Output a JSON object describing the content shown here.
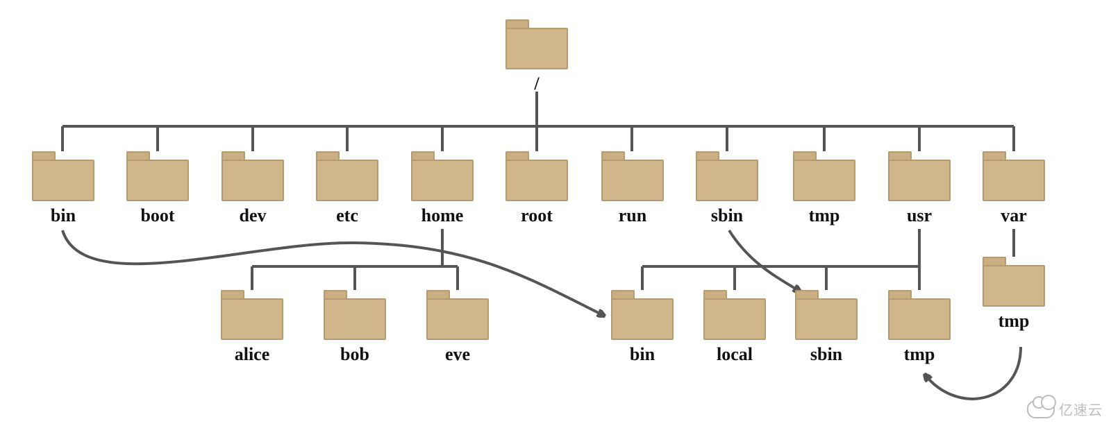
{
  "root": {
    "label": "/"
  },
  "level1": [
    {
      "id": "bin",
      "label": "bin"
    },
    {
      "id": "boot",
      "label": "boot"
    },
    {
      "id": "dev",
      "label": "dev"
    },
    {
      "id": "etc",
      "label": "etc"
    },
    {
      "id": "home",
      "label": "home"
    },
    {
      "id": "root",
      "label": "root"
    },
    {
      "id": "run",
      "label": "run"
    },
    {
      "id": "sbin",
      "label": "sbin"
    },
    {
      "id": "tmp",
      "label": "tmp"
    },
    {
      "id": "usr",
      "label": "usr"
    },
    {
      "id": "var",
      "label": "var"
    }
  ],
  "homeChildren": [
    {
      "id": "alice",
      "label": "alice"
    },
    {
      "id": "bob",
      "label": "bob"
    },
    {
      "id": "eve",
      "label": "eve"
    }
  ],
  "usrChildren": [
    {
      "id": "usr-bin",
      "label": "bin"
    },
    {
      "id": "usr-local",
      "label": "local"
    },
    {
      "id": "usr-sbin",
      "label": "sbin"
    },
    {
      "id": "usr-tmp",
      "label": "tmp"
    }
  ],
  "varChildren": [
    {
      "id": "var-tmp",
      "label": "tmp"
    }
  ],
  "symlinks": [
    {
      "from": "bin",
      "to": "usr/bin"
    },
    {
      "from": "sbin",
      "to": "usr/sbin"
    },
    {
      "from": "var/tmp",
      "to": "usr/tmp"
    }
  ],
  "watermark": "亿速云"
}
